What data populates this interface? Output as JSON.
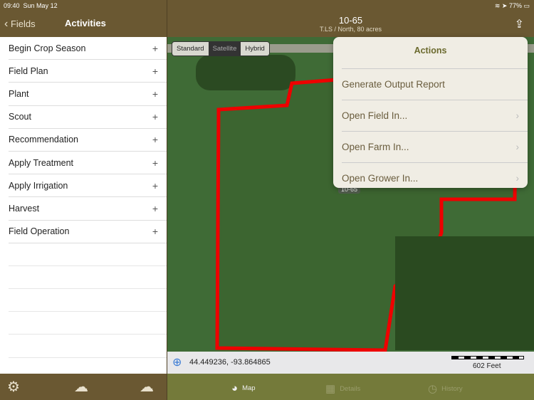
{
  "status": {
    "time": "09:40",
    "date": "Sun May 12",
    "battery": "77%"
  },
  "left_nav": {
    "back_label": "Fields",
    "title": "Activities"
  },
  "header": {
    "title": "10-65",
    "subtitle": "T.LS / North, 80 acres"
  },
  "activities": [
    {
      "label": "Begin Crop Season"
    },
    {
      "label": "Field Plan"
    },
    {
      "label": "Plant"
    },
    {
      "label": "Scout"
    },
    {
      "label": "Recommendation"
    },
    {
      "label": "Apply Treatment"
    },
    {
      "label": "Apply Irrigation"
    },
    {
      "label": "Harvest"
    },
    {
      "label": "Field Operation"
    }
  ],
  "map": {
    "types": [
      "Standard",
      "Satellite",
      "Hybrid"
    ],
    "selected": "Satellite",
    "field_label": "10-65",
    "coordinates": "44.449236, -93.864865",
    "scale": "602 Feet"
  },
  "actions": {
    "title": "Actions",
    "items": [
      {
        "label": "Generate Output Report"
      },
      {
        "label": "Open Field In..."
      },
      {
        "label": "Open Farm In..."
      },
      {
        "label": "Open Grower In..."
      }
    ]
  },
  "tabs": [
    {
      "label": "Map"
    },
    {
      "label": "Details"
    },
    {
      "label": "History"
    }
  ]
}
